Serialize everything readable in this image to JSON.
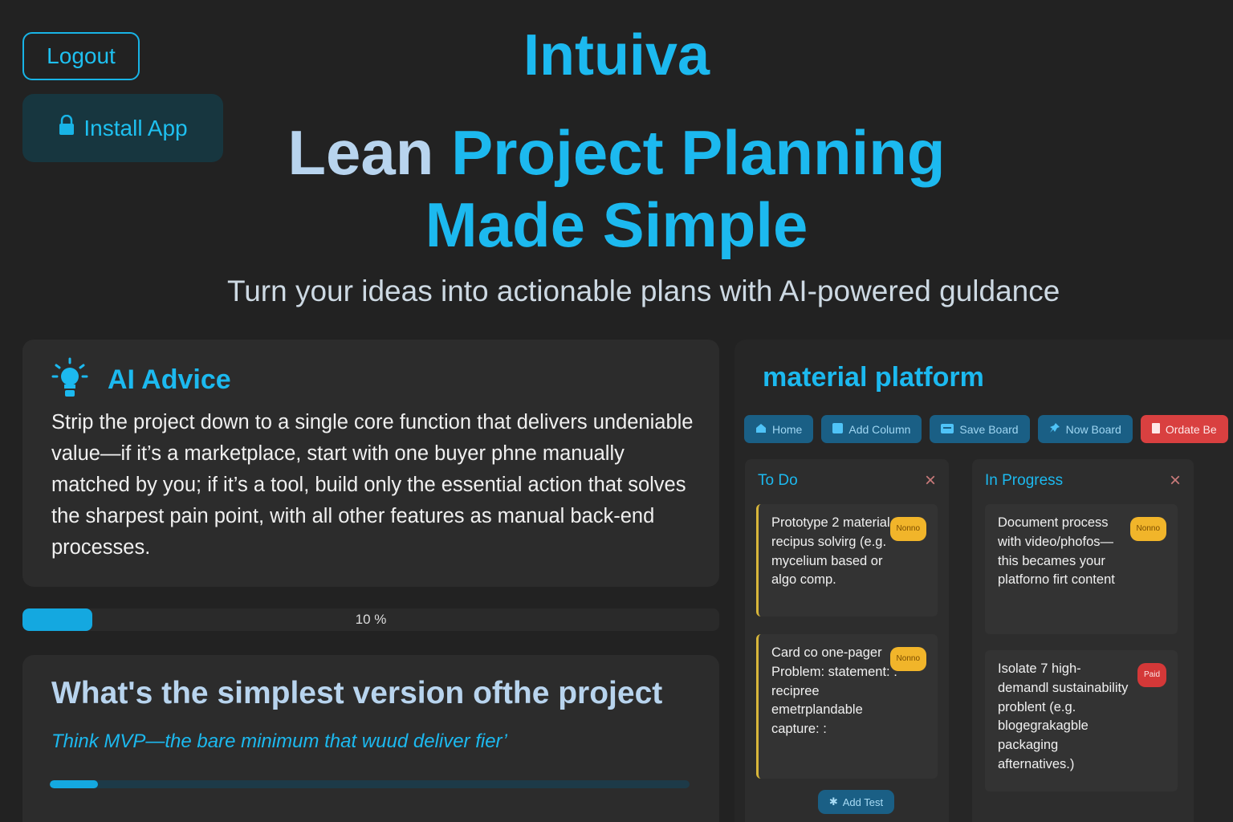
{
  "header": {
    "logout_label": "Logout",
    "install_label": "Install App",
    "brand": "Intuiva"
  },
  "hero": {
    "line1_plain": "Lean",
    "line1_accent": "Project Planning",
    "line2": "Made Simple",
    "subtitle": "Turn your ideas into actionable plans with AI-powered guldance"
  },
  "advice": {
    "title": "AI Advice",
    "text": "Strip the project down  to a single core function that delivers undeniable value—if it’s a marketplace, start with one buyer phne manually matched by you; if it’s a tool, build only the essential action that solves the sharpest pain point, with all other features as manual back-end processes."
  },
  "progress": {
    "label": "10 %",
    "value": 0.1
  },
  "question": {
    "title": "What's the simplest version ofthe project",
    "hint": "Think MVP—the bare minimum that wuud deliver fier’",
    "value": 0.075
  },
  "board": {
    "title": "material platform",
    "toolbar": [
      "Home",
      "Add Column",
      "Save Board",
      "Now Board",
      "Ordate Be"
    ],
    "columns": [
      {
        "title": "To Do",
        "tasks": [
          {
            "text": "Prototype 2 material recipus solvirg (e.g. mycelium based or algo comp.",
            "badge": "Nonno"
          },
          {
            "text": "Card co one-pager Problem: statement: : recipree emetrplandable capture: :",
            "badge": "Nonno"
          }
        ],
        "add_label": "Add Test"
      },
      {
        "title": "In Progress",
        "tasks": [
          {
            "text": "Document process with video/phofos— this becames your platforno firt content",
            "badge": "Nonno"
          },
          {
            "text": "Isolate 7 high-demandl sustainability problent (e.g. blogegrakagble packaging afternatives.)",
            "badge": "Paid"
          }
        ]
      }
    ]
  },
  "colors": {
    "accent": "#1cb9ef",
    "background": "#222222",
    "card": "#2c2c2c",
    "danger": "#d94040",
    "badge_yellow": "#f1b52a"
  }
}
